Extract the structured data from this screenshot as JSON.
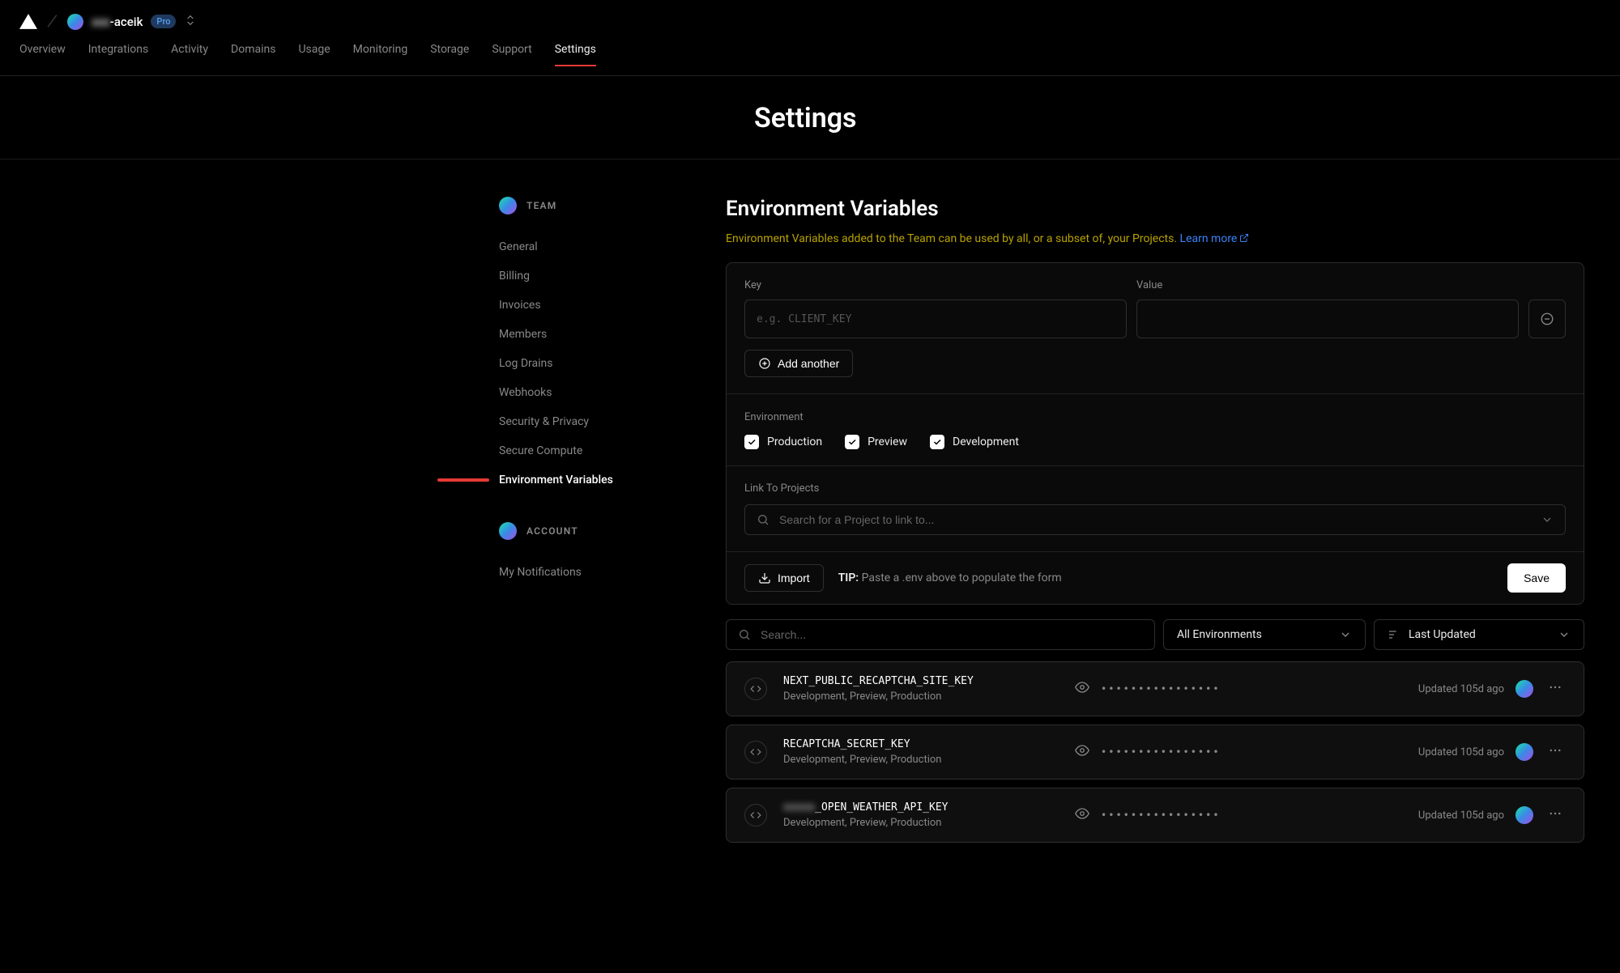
{
  "header": {
    "team_name_obscured": "xxx",
    "team_name_suffix": "-aceik",
    "plan_badge": "Pro"
  },
  "topnav": {
    "items": [
      "Overview",
      "Integrations",
      "Activity",
      "Domains",
      "Usage",
      "Monitoring",
      "Storage",
      "Support",
      "Settings"
    ],
    "active": "Settings"
  },
  "page_title": "Settings",
  "sidebar": {
    "section_team_label": "TEAM",
    "team_items": [
      "General",
      "Billing",
      "Invoices",
      "Members",
      "Log Drains",
      "Webhooks",
      "Security & Privacy",
      "Secure Compute",
      "Environment Variables"
    ],
    "team_active": "Environment Variables",
    "section_account_label": "ACCOUNT",
    "account_items": [
      "My Notifications"
    ]
  },
  "main": {
    "heading": "Environment Variables",
    "subtext": "Environment Variables added to the Team can be used by all, or a subset of, your Projects.",
    "learn_more": "Learn more",
    "form": {
      "key_label": "Key",
      "key_placeholder": "e.g. CLIENT_KEY",
      "value_label": "Value",
      "add_another": "Add another",
      "environment_label": "Environment",
      "env_options": [
        "Production",
        "Preview",
        "Development"
      ],
      "link_projects_label": "Link To Projects",
      "link_projects_placeholder": "Search for a Project to link to...",
      "import_label": "Import",
      "tip_prefix": "TIP:",
      "tip_text": " Paste a .env above to populate the form",
      "save_label": "Save"
    },
    "filters": {
      "search_placeholder": "Search...",
      "env_filter": "All Environments",
      "sort_by": "Last Updated"
    },
    "vars": [
      {
        "key_prefix": "",
        "key": "NEXT_PUBLIC_RECAPTCHA_SITE_KEY",
        "envs": "Development, Preview, Production",
        "masked": "••••••••••••••••",
        "updated": "Updated 105d ago"
      },
      {
        "key_prefix": "",
        "key": "RECAPTCHA_SECRET_KEY",
        "envs": "Development, Preview, Production",
        "masked": "••••••••••••••••",
        "updated": "Updated 105d ago"
      },
      {
        "key_prefix": "xxxxx",
        "key": "_OPEN_WEATHER_API_KEY",
        "envs": "Development, Preview, Production",
        "masked": "••••••••••••••••",
        "updated": "Updated 105d ago"
      }
    ]
  }
}
